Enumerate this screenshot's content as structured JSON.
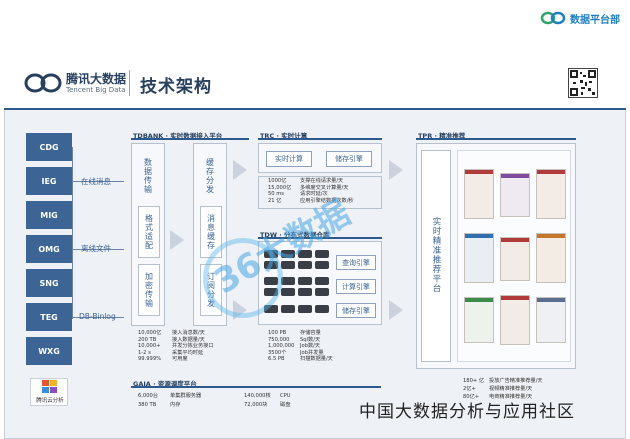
{
  "brand_top": "数据平台部",
  "logo": {
    "cn": "腾讯大数据",
    "en": "Tencent Big Data"
  },
  "title": "技术架构",
  "sources": [
    "CDG",
    "IEG",
    "MIG",
    "OMG",
    "SNG",
    "TEG",
    "WXG"
  ],
  "source_logo": "腾讯云分析",
  "flows": [
    "在线消息",
    "离线文件",
    "DB-Binlog"
  ],
  "tdbank": {
    "title": "TDBANK · 实时数据接入平台",
    "col1": [
      "数据传输",
      "格式适配",
      "加密传输"
    ],
    "col2": [
      "缓存分发",
      "消息缓存",
      "订阅分发"
    ],
    "stats": [
      [
        "10,000亿",
        "接入消息数/天"
      ],
      [
        "200 TB",
        "接入数据量/天"
      ],
      [
        "10,000+",
        "并发分拣业务接口"
      ],
      [
        "1-2 s",
        "采集平均时延"
      ],
      [
        "99.999%",
        "可用度"
      ]
    ]
  },
  "trc": {
    "title": "TRC · 实时计算",
    "buttons": [
      "实时计算",
      "储存引擎"
    ],
    "stats": [
      [
        "1000亿",
        "支撑在线请求量/天"
      ],
      [
        "15,000亿",
        "多维度交叉计算量/天"
      ],
      [
        "50 ms",
        "请求时延/次"
      ],
      [
        "21 亿",
        "应用引擎结数据次数/秒"
      ]
    ]
  },
  "tdw": {
    "title": "TDW · 分布式数据仓库",
    "buttons": [
      "查询引擎",
      "计算引擎",
      "储存引擎"
    ],
    "stats": [
      [
        "100 PB",
        "存储容量"
      ],
      [
        "750,000",
        "Sql数/天"
      ],
      [
        "1,000,000",
        "Job数/天"
      ],
      [
        "3500个",
        "Job并发量"
      ],
      [
        "6.5 PB",
        "扫描数据量/天"
      ]
    ]
  },
  "gaia": {
    "title": "GAIA · 资源调度平台",
    "stats": [
      [
        "6,000台",
        "单集群服务器",
        "140,000核",
        "CPU"
      ],
      [
        "380 TB",
        "内存",
        "72,000块",
        "磁盘"
      ]
    ]
  },
  "tpr": {
    "title": "TPR · 精准推荐",
    "vertical": "实时精准推荐平台",
    "stats": [
      [
        "180+ 亿",
        "投放广告精准推荐量/天"
      ],
      [
        "2亿+",
        "视频精准推荐量/天"
      ],
      [
        "80亿+",
        "电商精准推荐量/天"
      ]
    ]
  },
  "watermark": "中国大数据分析与应用社区",
  "watermark_logo": "36大数据"
}
